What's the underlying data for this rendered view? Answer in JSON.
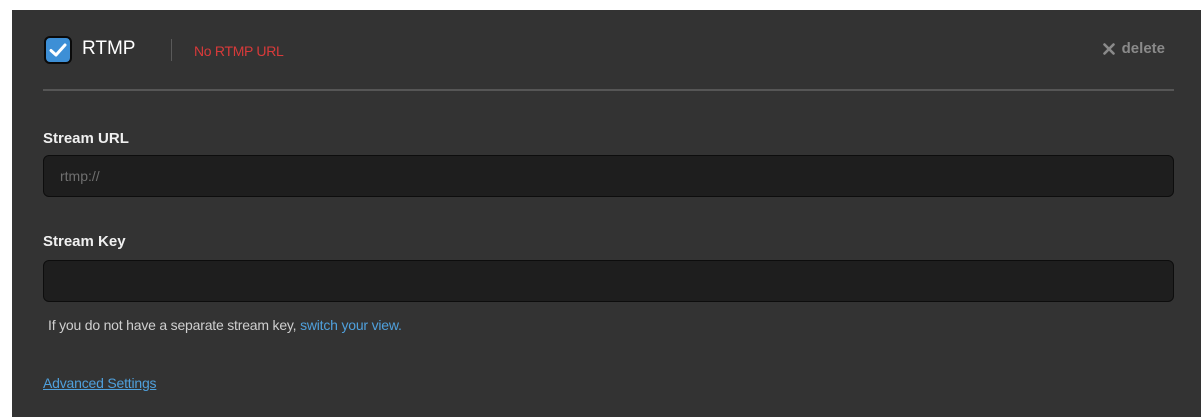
{
  "destination": {
    "enabled": true,
    "service_name": "RTMP",
    "status_error": "No RTMP URL",
    "delete_label": "delete",
    "icons": {
      "checkbox": "checkmark-icon",
      "delete": "x-icon"
    }
  },
  "stream_url": {
    "label": "Stream URL",
    "value": "",
    "placeholder": "rtmp://"
  },
  "stream_key": {
    "label": "Stream Key",
    "value": "",
    "placeholder": ""
  },
  "helper": {
    "text": "If you do not have a separate stream key,",
    "link_text": "switch your view."
  },
  "advanced_link": "Advanced Settings",
  "colors": {
    "panel_bg": "#333333",
    "accent": "#3d8fd6",
    "error": "#d83a3a",
    "link": "#4fa0dc",
    "input_bg": "#1e1e1e"
  }
}
